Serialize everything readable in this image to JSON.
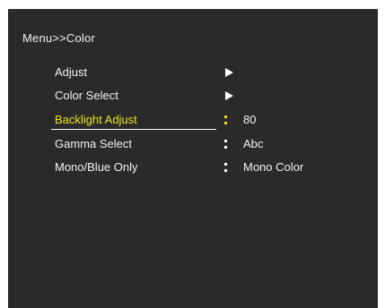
{
  "breadcrumb": "Menu>>Color",
  "colors": {
    "panel_background": "#2a2a2a",
    "text": "#f2f2f2",
    "selected_text": "#f0e020"
  },
  "menu": {
    "items": [
      {
        "label": "Adjust",
        "indicator": "submenu-arrow-icon",
        "value": ""
      },
      {
        "label": "Color Select",
        "indicator": "submenu-arrow-icon",
        "value": ""
      },
      {
        "label": "Backlight Adjust",
        "indicator": "colon",
        "value": "80",
        "selected": true
      },
      {
        "label": "Gamma Select",
        "indicator": "colon",
        "value": "Abc"
      },
      {
        "label": "Mono/Blue Only",
        "indicator": "colon",
        "value": "Mono Color"
      }
    ]
  }
}
